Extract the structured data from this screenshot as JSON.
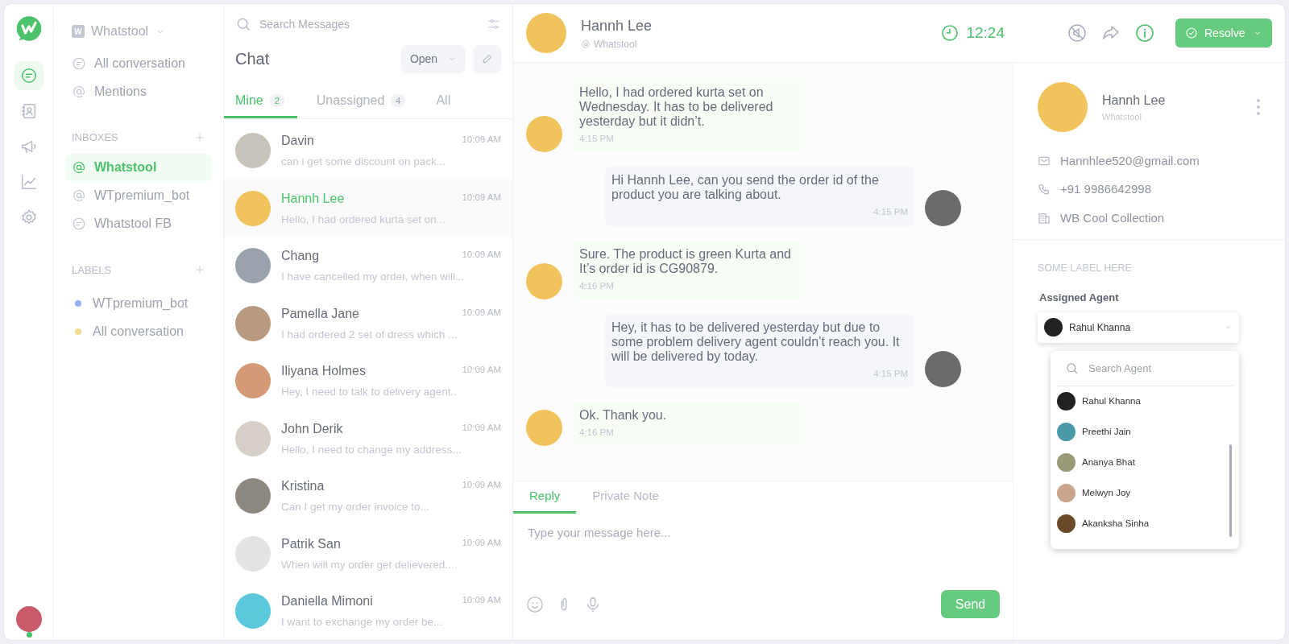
{
  "rail": {
    "items": [
      {
        "kind": "chat",
        "selected": true
      },
      {
        "kind": "contacts",
        "selected": false
      },
      {
        "kind": "megaphone",
        "selected": false
      },
      {
        "kind": "chart",
        "selected": false
      },
      {
        "kind": "settings",
        "selected": false
      }
    ],
    "user": {
      "online": true
    }
  },
  "sidebar": {
    "workspace": {
      "initial": "W",
      "name": "Whatstool"
    },
    "nav": [
      {
        "kind": "chat",
        "label": "All conversation"
      },
      {
        "kind": "at",
        "label": "Mentions"
      }
    ],
    "inboxes_title": "INBOXES",
    "inboxes": [
      {
        "kind": "at",
        "label": "Whatstool",
        "selected": true
      },
      {
        "kind": "at",
        "label": "WTpremium_bot",
        "selected": false
      },
      {
        "kind": "chat",
        "label": "Whatstool FB",
        "selected": false
      }
    ],
    "labels_title": "LABELS",
    "labels": [
      {
        "label": "WTpremium_bot",
        "color": "#8fb0f0"
      },
      {
        "label": "All conversation",
        "color": "#f3dc8e"
      }
    ]
  },
  "chat_list": {
    "search_placeholder": "Search Messages",
    "title": "Chat",
    "status": "Open",
    "tabs": [
      {
        "label": "Mine",
        "count": "2",
        "selected": true
      },
      {
        "label": "Unassigned",
        "count": "4",
        "selected": false
      },
      {
        "label": "All",
        "selected": false
      }
    ],
    "conversations": [
      {
        "name": "Davin",
        "preview": "can i get some discount on pack...",
        "time": "10:09 AM",
        "selected": false
      },
      {
        "name": "Hannh Lee",
        "preview": "Hello, I had ordered kurta set on...",
        "time": "10:09 AM",
        "selected": true
      },
      {
        "name": "Chang",
        "preview": "I have cancelled my order, when will...",
        "time": "10:09 AM",
        "selected": false
      },
      {
        "name": "Pamella Jane",
        "preview": "I had ordered 2 set of dress which ...",
        "time": "10:09 AM",
        "selected": false
      },
      {
        "name": "Iliyana Holmes",
        "preview": "Hey, I need to talk to delivery agent..",
        "time": "10:09 AM",
        "selected": false
      },
      {
        "name": "John Derik",
        "preview": "Hello, I need to change my address...",
        "time": "10:09 AM",
        "selected": false
      },
      {
        "name": "Kristina",
        "preview": "Can I get my order invoice to...",
        "time": "10:09 AM",
        "selected": false
      },
      {
        "name": "Patrik San",
        "preview": "When will my order get delievered...",
        "time": "10:09 AM",
        "selected": false
      },
      {
        "name": "Daniella Mimoni",
        "preview": "I want to exchange my order be...",
        "time": "10:09 AM",
        "selected": false
      }
    ]
  },
  "conversation": {
    "name": "Hannh Lee",
    "channel": "Whatstool",
    "timer": "12:24",
    "resolve": "Resolve",
    "messages": [
      {
        "kind": "incoming",
        "text": "Hello, I had ordered kurta set on Wednesday. It has to be delivered yesterday but it didn’t.",
        "time": "4:15 PM"
      },
      {
        "kind": "outgoing",
        "text": "Hi Hannh Lee, can you send the order id of the product you are talking about.",
        "time": "4:15 PM"
      },
      {
        "kind": "incoming",
        "text": "Sure. The product is green Kurta and It’s order id is CG90879.",
        "time": "4:16 PM"
      },
      {
        "kind": "outgoing",
        "text": "Hey, it has to be delivered yesterday but due to some problem delivery agent couldn’t reach you. It will be delivered by today.",
        "time": "4:15 PM"
      },
      {
        "kind": "incoming",
        "text": "Ok. Thank you.",
        "time": "4:16 PM"
      }
    ],
    "composer": {
      "tabs": [
        {
          "label": "Reply",
          "selected": true
        },
        {
          "label": "Private Note",
          "selected": false
        }
      ],
      "placeholder": "Type your message here...",
      "send": "Send"
    }
  },
  "contact": {
    "name": "Hannh Lee",
    "subtitle": "Whatstool",
    "details": [
      {
        "kind": "email",
        "text": "Hannhlee520@gmail.com"
      },
      {
        "kind": "phone",
        "text": "+91 9986642998"
      },
      {
        "kind": "company",
        "text": "WB Cool Collection"
      }
    ],
    "section_label": "SOME LABEL HERE",
    "assigned_label": "Assigned Agent",
    "assigned_agent": "Rahul Khanna",
    "agent_search_placeholder": "Search Agent",
    "agents": [
      "Rahul Khanna",
      "Preethi Jain",
      "Ananya Bhat",
      "Melwyn Joy",
      "Akanksha Sinha"
    ]
  }
}
